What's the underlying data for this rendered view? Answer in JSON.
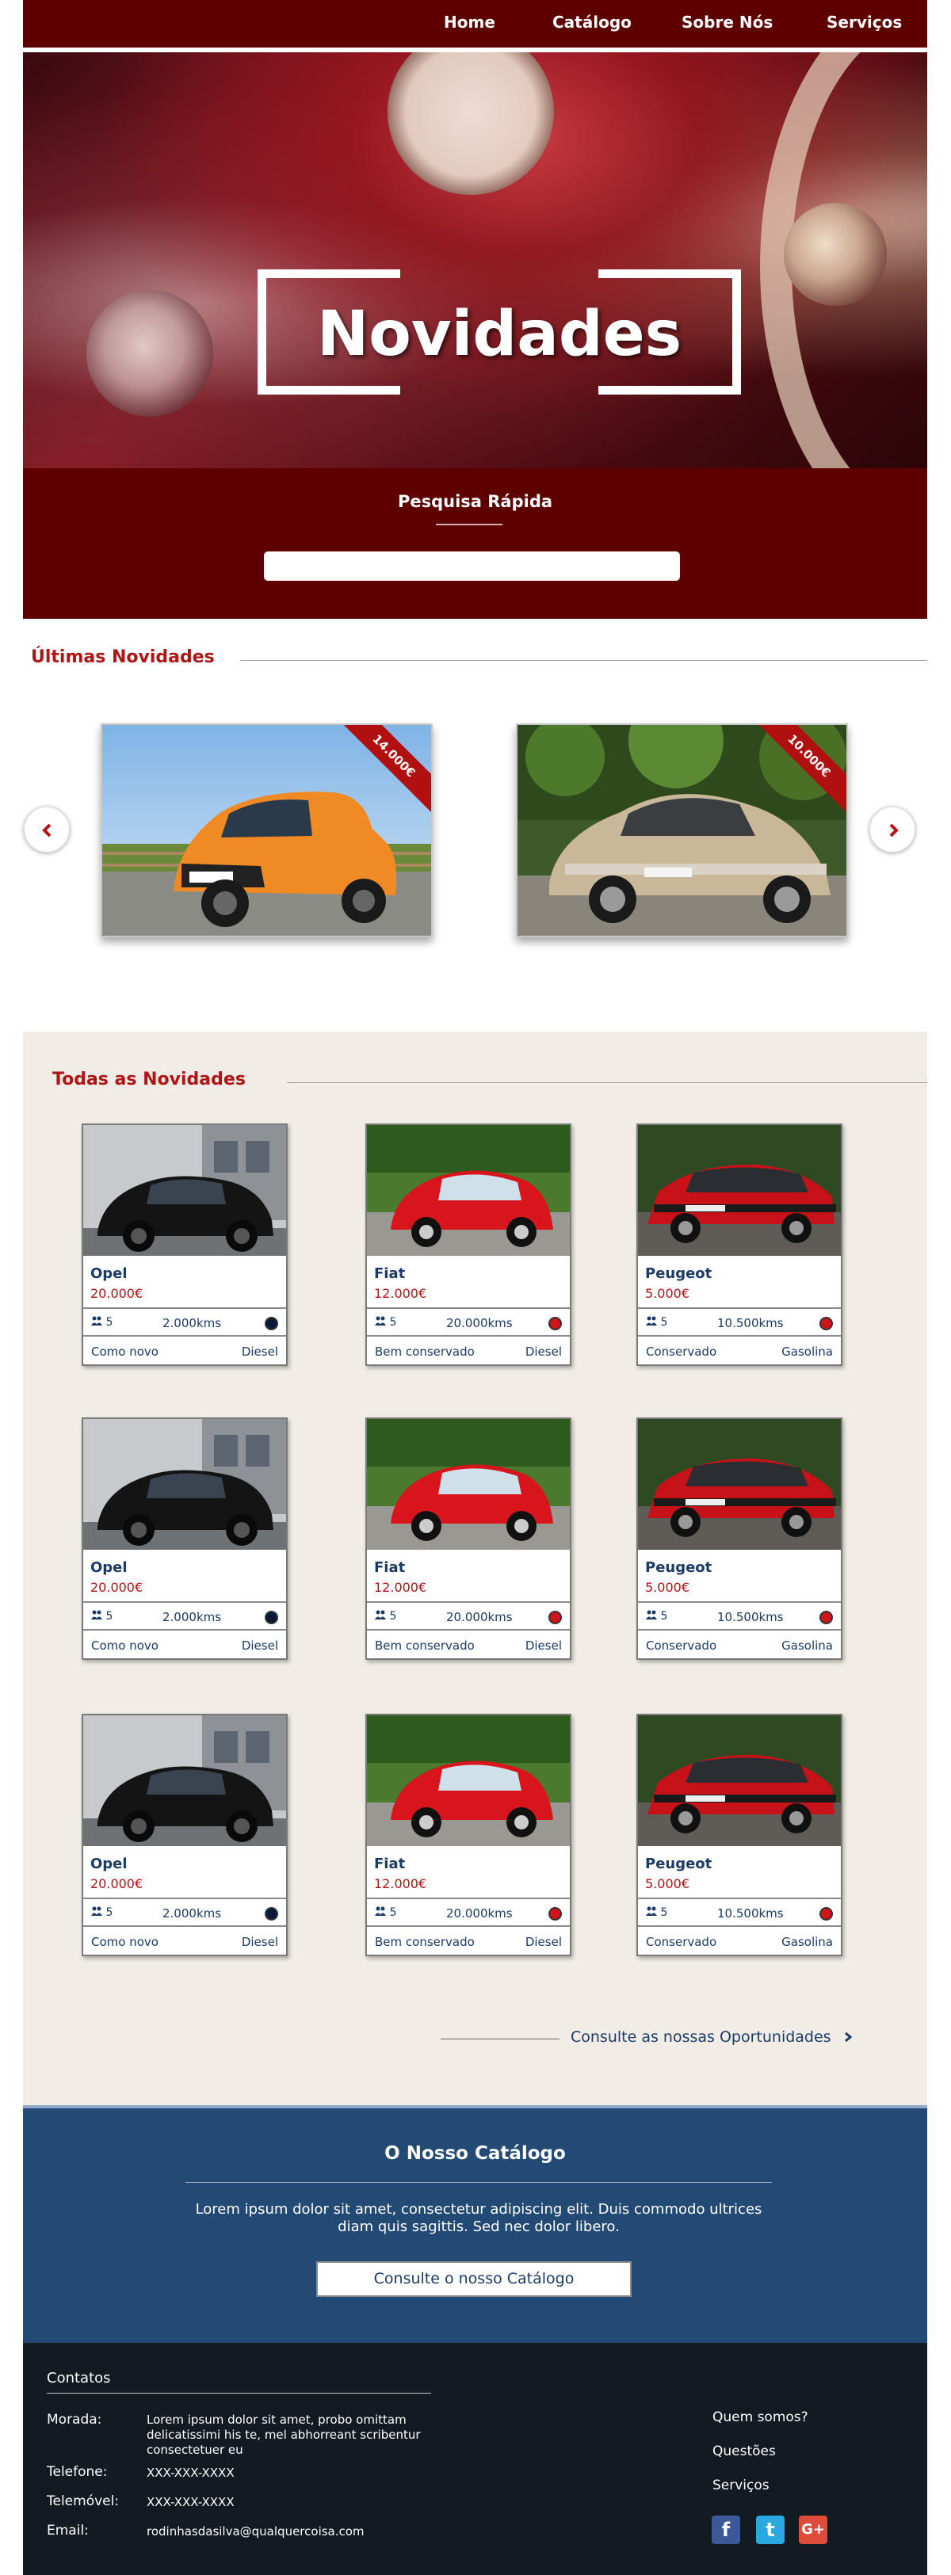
{
  "nav": {
    "items": [
      {
        "label": "Home"
      },
      {
        "label": "Catálogo"
      },
      {
        "label": "Sobre Nós"
      },
      {
        "label": "Serviços"
      }
    ]
  },
  "hero": {
    "title": "Novidades"
  },
  "quick_search": {
    "title": "Pesquisa Rápida",
    "placeholder": ""
  },
  "latest": {
    "title": "Últimas Novidades",
    "slides": [
      {
        "ribbon": "14.000€"
      },
      {
        "ribbon": "10.000€"
      }
    ]
  },
  "all": {
    "title": "Todas as Novidades",
    "cards": [
      {
        "name": "Opel",
        "price": "20.000€",
        "seats": "5",
        "km": "2.000kms",
        "condition": "Como novo",
        "fuel": "Diesel",
        "color": "#0b1838"
      },
      {
        "name": "Fiat",
        "price": "12.000€",
        "seats": "5",
        "km": "20.000kms",
        "condition": "Bem conservado",
        "fuel": "Diesel",
        "color": "#d0141a"
      },
      {
        "name": "Peugeot",
        "price": "5.000€",
        "seats": "5",
        "km": "10.500kms",
        "condition": "Conservado",
        "fuel": "Gasolina",
        "color": "#d0141a"
      }
    ],
    "opportunities_link": "Consulte as nossas Oportunidades"
  },
  "catalog": {
    "title": "O Nosso Catálogo",
    "text": "Lorem ipsum dolor sit amet, consectetur adipiscing elit. Duis commodo ultrices diam quis sagittis. Sed nec dolor libero.",
    "button": "Consulte o nosso Catálogo"
  },
  "footer": {
    "title": "Contatos",
    "address_label": "Morada:",
    "address": "Lorem ipsum dolor sit amet, probo omittam delicatissimi his te, mel abhorreant scribentur consectetuer eu",
    "phone_label": "Telefone:",
    "phone": "XXX-XXX-XXXX",
    "mobile_label": "Telemóvel:",
    "mobile": "XXX-XXX-XXXX",
    "email_label": "Email:",
    "email": "rodinhasdasilva@qualquercoisa.com",
    "links": [
      "Quem somos?",
      "Questões",
      "Serviços"
    ],
    "social": [
      {
        "icon": "facebook-icon",
        "glyph": "f",
        "color": "#3b5998"
      },
      {
        "icon": "twitter-icon",
        "glyph": "t",
        "color": "#2aa9e0"
      },
      {
        "icon": "google-plus-icon",
        "glyph": "G+",
        "color": "#dd4b39"
      }
    ]
  }
}
